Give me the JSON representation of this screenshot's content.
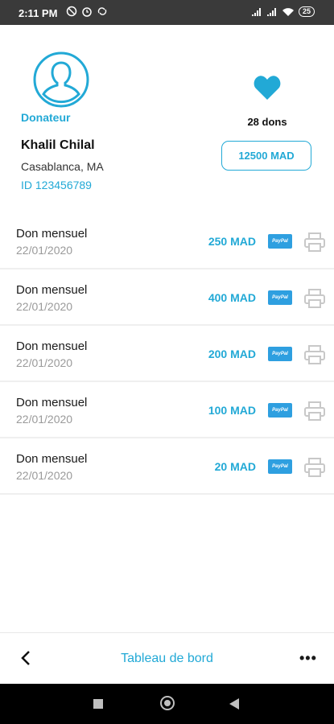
{
  "status_bar": {
    "time": "2:11 PM",
    "battery": "25",
    "left_icons": [
      "no-disturb-icon",
      "alarm-icon",
      "sync-icon"
    ],
    "right_icons": [
      "signal-icon",
      "signal-icon",
      "wifi-icon",
      "battery-icon"
    ]
  },
  "profile": {
    "role": "Donateur",
    "name": "Khalil Chilal",
    "city": "Casablanca, MA",
    "id": "ID 123456789",
    "dons_count": "28 dons",
    "total": "12500 MAD"
  },
  "donations": [
    {
      "title": "Don mensuel",
      "date": "22/01/2020",
      "amount": "250 MAD",
      "method": "PayPal"
    },
    {
      "title": "Don mensuel",
      "date": "22/01/2020",
      "amount": "400 MAD",
      "method": "PayPal"
    },
    {
      "title": "Don mensuel",
      "date": "22/01/2020",
      "amount": "200 MAD",
      "method": "PayPal"
    },
    {
      "title": "Don mensuel",
      "date": "22/01/2020",
      "amount": "100 MAD",
      "method": "PayPal"
    },
    {
      "title": "Don mensuel",
      "date": "22/01/2020",
      "amount": "20 MAD",
      "method": "PayPal"
    }
  ],
  "bottom_bar": {
    "title": "Tableau de bord",
    "more": "•••"
  },
  "colors": {
    "accent": "#22a9d6",
    "date_gray": "#9a9a9a",
    "status_bar": "#3a3a3a"
  }
}
